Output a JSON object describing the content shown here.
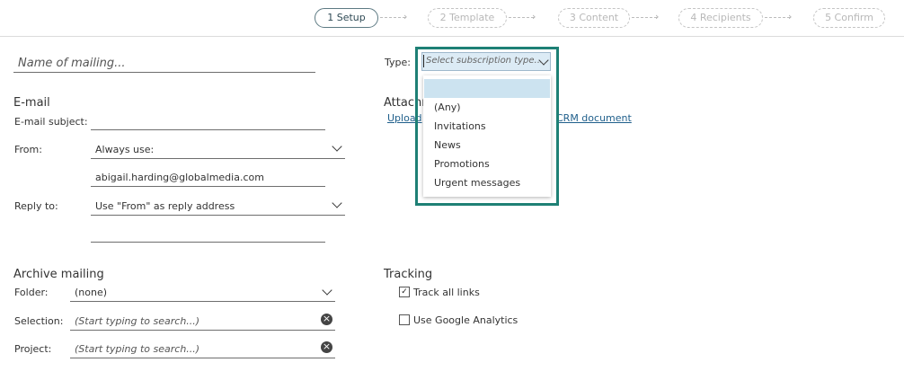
{
  "steps": [
    {
      "label": "1 Setup"
    },
    {
      "label": "2 Template"
    },
    {
      "label": "3 Content"
    },
    {
      "label": "4 Recipients"
    },
    {
      "label": "5 Confirm"
    }
  ],
  "mailing_name": {
    "placeholder": "Name of mailing..."
  },
  "email": {
    "title": "E-mail",
    "subject_label": "E-mail subject:",
    "from_label": "From:",
    "from_value": "Always use:",
    "from_address": "abigail.harding@globalmedia.com",
    "reply_label": "Reply to:",
    "reply_value": "Use \"From\" as reply address"
  },
  "type_field": {
    "label": "Type:",
    "placeholder": "Select subscription type...",
    "options": [
      "(Any)",
      "Invitations",
      "News",
      "Promotions",
      "Urgent messages"
    ]
  },
  "attachments": {
    "title_visible": "Attachm",
    "upload_visible": "Upload",
    "crm_visible": "CRM document"
  },
  "archive": {
    "title": "Archive mailing",
    "folder_label": "Folder:",
    "folder_value": "(none)",
    "selection_label": "Selection:",
    "selection_placeholder": "(Start typing to search...)",
    "project_label": "Project:",
    "project_placeholder": "(Start typing to search...)"
  },
  "tracking": {
    "title": "Tracking",
    "track_links_label": "Track all links",
    "track_links_checked": true,
    "google_label": "Use Google Analytics",
    "google_checked": false
  }
}
